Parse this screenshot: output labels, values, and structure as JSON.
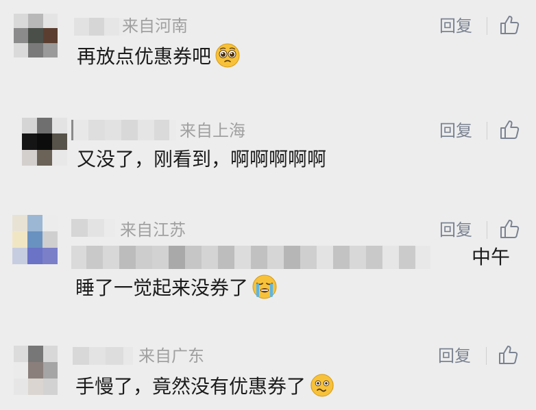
{
  "comments": [
    {
      "location": "来自河南",
      "text": "再放点优惠券吧",
      "reply_label": "回复",
      "emoji": "pleading-face-emoji"
    },
    {
      "location": "来自上海",
      "text": "又没了，刚看到，啊啊啊啊啊",
      "reply_label": "回复"
    },
    {
      "location": "来自江苏",
      "text_line1_tail": "中午",
      "text_line2": "睡了一觉起来没券了",
      "reply_label": "回复",
      "emoji": "loudly-crying-face-emoji"
    },
    {
      "location": "来自广东",
      "text": "手慢了，竟然没有优惠券了",
      "reply_label": "回复",
      "emoji": "shaking-face-emoji"
    }
  ],
  "colors": {
    "background": "#ededed",
    "location_text": "#a0a0a0",
    "reply_text": "#7a8291",
    "comment_text": "#1b1b1b"
  }
}
